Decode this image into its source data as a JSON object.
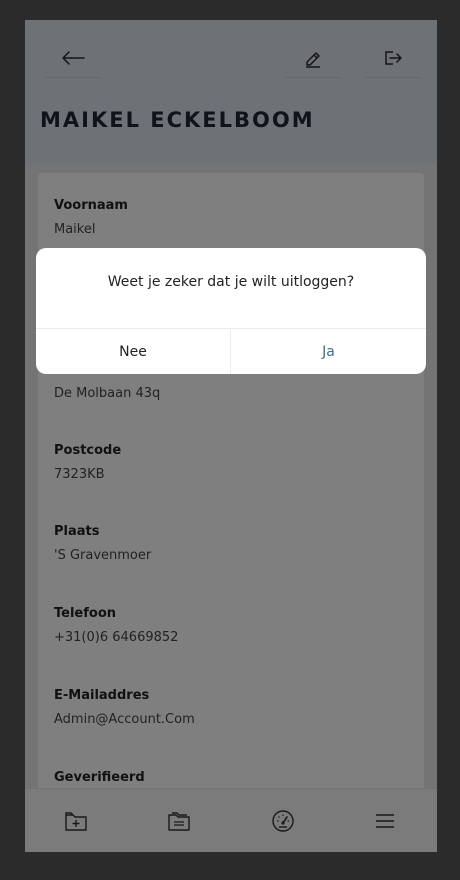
{
  "header": {
    "title": "MAIKEL ECKELBOOM",
    "icons": {
      "back": "arrow-left-icon",
      "edit": "pencil-icon",
      "logout": "logout-icon"
    }
  },
  "fields": [
    {
      "label": "Voornaam",
      "value": "Maikel"
    },
    {
      "label": "",
      "value": "De Molbaan 43q"
    },
    {
      "label": "Postcode",
      "value": "7323KB"
    },
    {
      "label": "Plaats",
      "value": "'S Gravenmoer"
    },
    {
      "label": "Telefoon",
      "value": "+31(0)6 64669852"
    },
    {
      "label": "E-Mailaddres",
      "value": "Admin@Account.Com"
    },
    {
      "label": "Geverifieerd",
      "value": ""
    }
  ],
  "dialog": {
    "message": "Weet je zeker dat je wilt uitloggen?",
    "no_label": "Nee",
    "yes_label": "Ja"
  },
  "bottom_nav": {
    "icons": [
      "folder-plus-icon",
      "folder-icon",
      "speedometer-icon",
      "menu-icon"
    ]
  },
  "colors": {
    "header_bg": "#dde3ec",
    "backdrop": "#2b2b2b",
    "accent": "#3a6f9a"
  }
}
